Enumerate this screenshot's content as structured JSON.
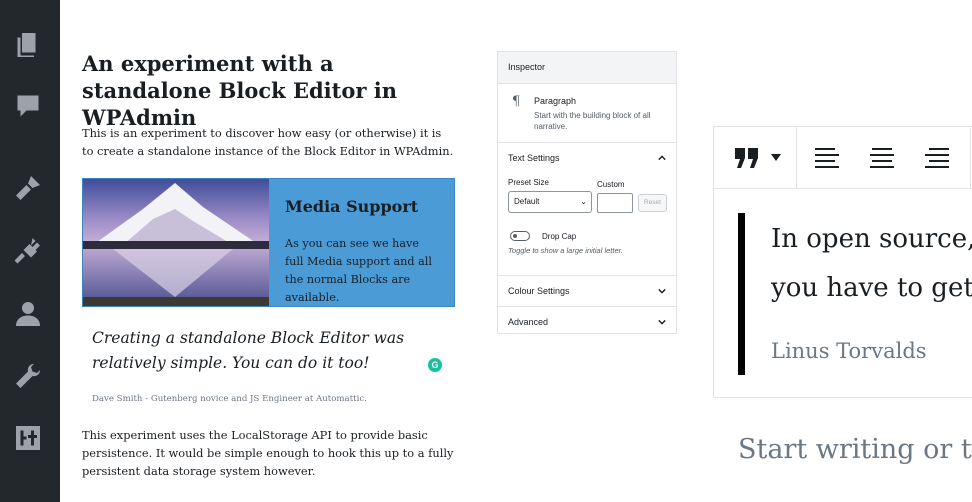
{
  "sidebar": {
    "icons": [
      "pages-icon",
      "comments-icon",
      "appearance-icon",
      "plugins-icon",
      "users-icon",
      "tools-icon",
      "settings-icon"
    ]
  },
  "document": {
    "title": "An experiment with a standalone Block Editor in WPAdmin",
    "intro": "This is an experiment to discover how easy (or otherwise) it is to create a standalone instance of the Block Editor in WPAdmin.",
    "media": {
      "title": "Media Support",
      "text": "As you can see we have full Media support and all the normal Blocks are available."
    },
    "quote": "Creating a standalone Block Editor was relatively simple. You can do it too!",
    "citation": "Dave Smith - Gutenberg novice and JS Engineer at Automattic.",
    "outro": "This experiment uses the LocalStorage API to provide basic persistence. It would be simple enough to hook this up to a fully persistent data storage system however."
  },
  "inspector": {
    "title": "Inspector",
    "block_name": "Paragraph",
    "block_description": "Start with the building block of all narrative.",
    "text_settings": {
      "title": "Text Settings",
      "preset_size_label": "Preset Size",
      "preset_size_value": "Default",
      "custom_label": "Custom",
      "reset_label": "Reset",
      "drop_cap_label": "Drop Cap",
      "drop_cap_help": "Toggle to show a large initial letter."
    },
    "colour_settings": "Colour Settings",
    "advanced": "Advanced"
  },
  "zoomed": {
    "quote_line_1": "In open source,",
    "quote_line_2": "you have to get",
    "citation": "Linus Torvalds",
    "placeholder": "Start writing or typ"
  }
}
